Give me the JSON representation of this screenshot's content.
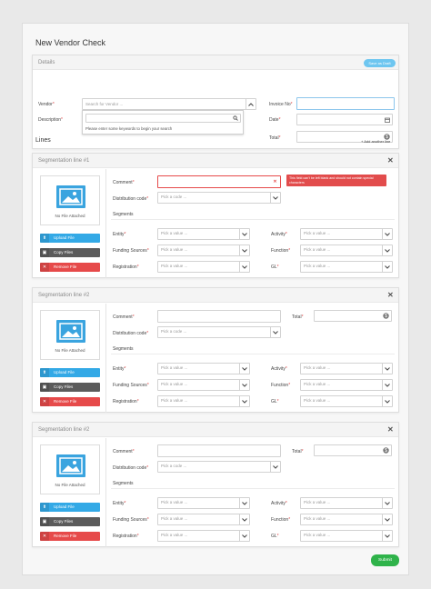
{
  "page_title": "New Vendor Check",
  "details": {
    "header": "Details",
    "save_draft": "Save as Draft",
    "vendor_label": "Vendor",
    "vendor_placeholder": "Search for Vendor ...",
    "description_label": "Description",
    "search_hint": "Please enter some keywords to begin your search",
    "invoice_label": "Invoice No",
    "date_label": "Date",
    "total_label": "Total"
  },
  "lines": {
    "title": "Lines",
    "add_another": "+ Add another line"
  },
  "segments": [
    {
      "title": "Segmentation line #1",
      "no_file": "No File Attached",
      "upload": "Upload File",
      "copy": "Copy Files",
      "remove": "Remove File",
      "comment_label": "Comment",
      "error_tooltip": "This field can't be left blank and should not contain special characters",
      "distribution_label": "Distribution code",
      "distribution_placeholder": "Pick a code ...",
      "segments_label": "Segments",
      "entity_label": "Entity",
      "funding_label": "Funding Sources",
      "registration_label": "Registration",
      "activity_label": "Activity",
      "function_label": "Function",
      "gl_label": "GL",
      "pick_value": "Pick a value ..."
    },
    {
      "title": "Segmentation line #2",
      "no_file": "No File Attached",
      "upload": "Upload File",
      "copy": "Copy Files",
      "remove": "Remove File",
      "comment_label": "Comment",
      "total_label": "Total",
      "distribution_label": "Distribution code",
      "distribution_placeholder": "Pick a code ...",
      "segments_label": "Segments",
      "entity_label": "Entity",
      "funding_label": "Funding Sources",
      "registration_label": "Registration",
      "activity_label": "Activity",
      "function_label": "Function",
      "gl_label": "GL",
      "pick_value": "Pick a value ..."
    },
    {
      "title": "Segmentation line #2",
      "no_file": "No File Attached",
      "upload": "Upload File",
      "copy": "Copy Files",
      "remove": "Remove File",
      "comment_label": "Comment",
      "total_label": "Total",
      "distribution_label": "Distribution code",
      "distribution_placeholder": "Pick a code ...",
      "segments_label": "Segments",
      "entity_label": "Entity",
      "funding_label": "Funding Sources",
      "registration_label": "Registration",
      "activity_label": "Activity",
      "function_label": "Function",
      "gl_label": "GL",
      "pick_value": "Pick a value ..."
    }
  ],
  "submit": "Submit",
  "colors": {
    "accent_blue": "#33a9e6",
    "danger": "#e64a4a",
    "success": "#2fb34a",
    "dark": "#5b5b5b"
  },
  "icons": [
    "chevron-up-icon",
    "search-icon",
    "calendar-icon",
    "dollar-icon",
    "close-icon",
    "image-icon",
    "upload-icon",
    "copy-icon",
    "remove-icon",
    "chevron-down-icon"
  ]
}
